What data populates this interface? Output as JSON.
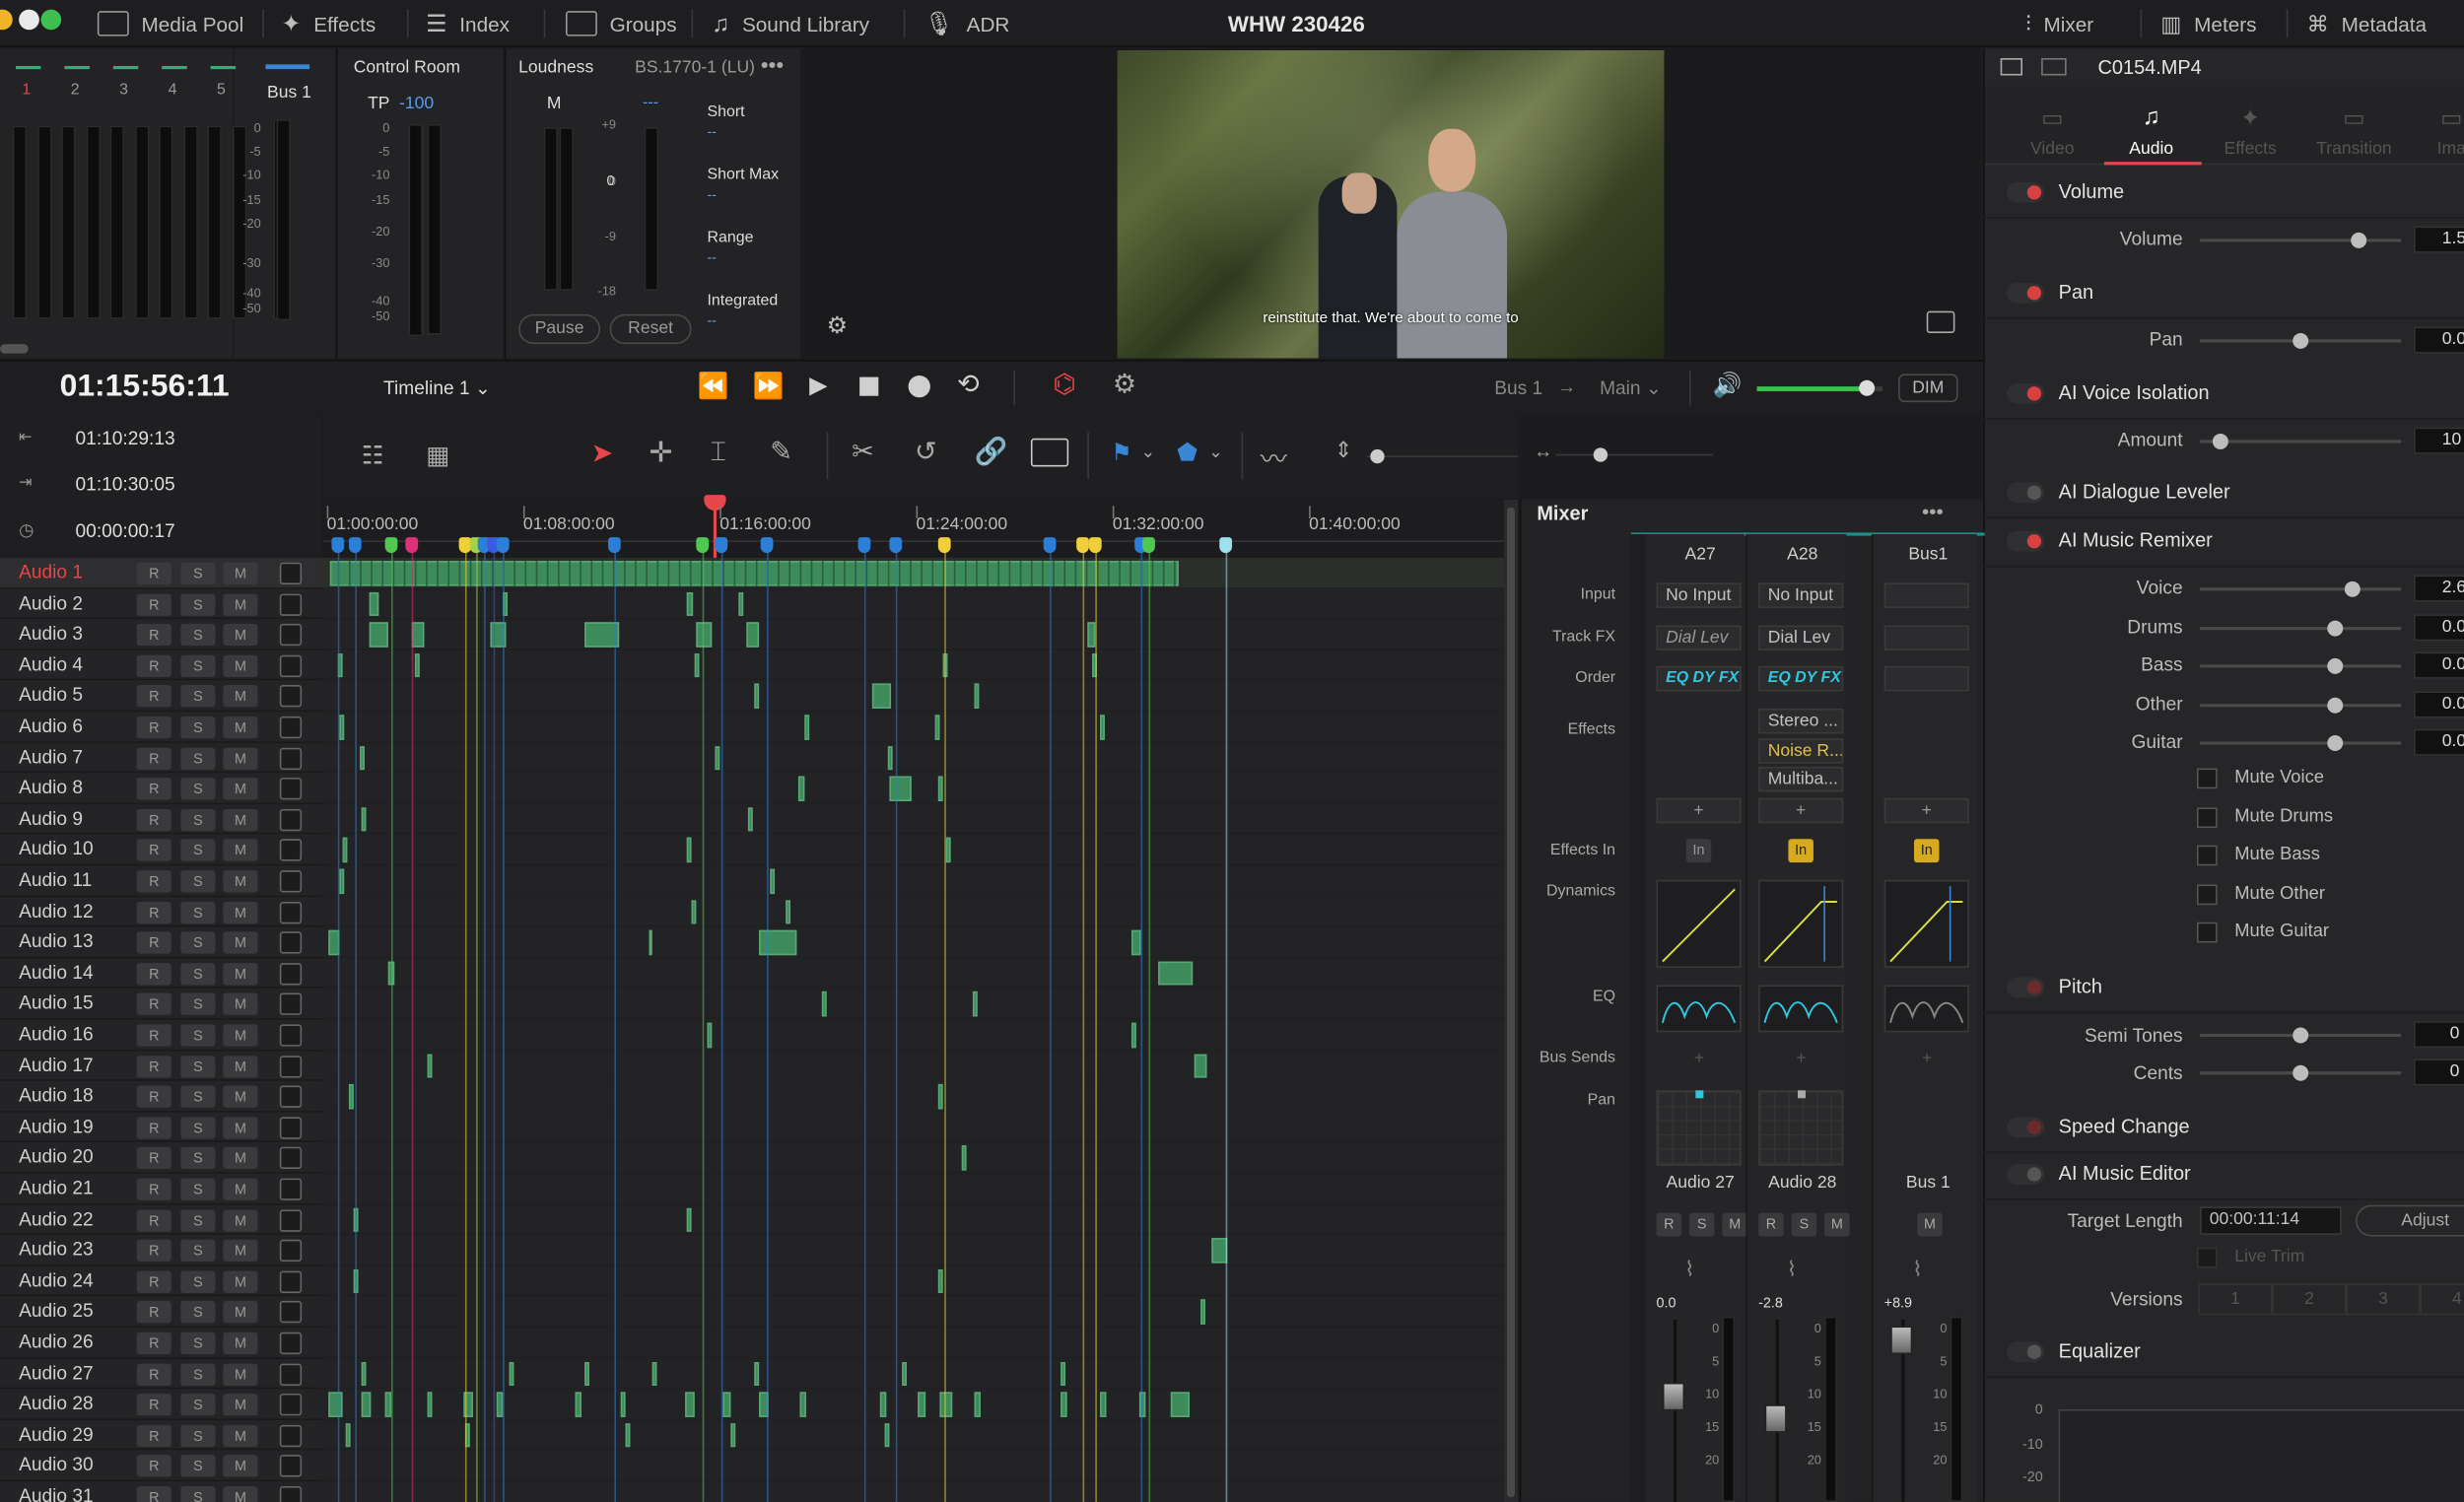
{
  "topbar": {
    "media_pool": "Media Pool",
    "effects": "Effects",
    "index": "Index",
    "groups": "Groups",
    "sound_library": "Sound Library",
    "adr": "ADR",
    "project_title": "WHW 230426",
    "mixer": "Mixer",
    "meters": "Meters",
    "metadata": "Metadata"
  },
  "meters": {
    "channels": [
      "1",
      "2",
      "3",
      "4",
      "5"
    ],
    "bus_label": "Bus 1",
    "scale": [
      "0",
      "-5",
      "-10",
      "-15",
      "-20",
      "-30",
      "-40",
      "-50"
    ]
  },
  "control_room": {
    "title": "Control Room",
    "tp_label": "TP",
    "tp_value": "-100",
    "scale": [
      "0",
      "-5",
      "-10",
      "-15",
      "-20",
      "-30",
      "-40",
      "-50"
    ]
  },
  "loudness": {
    "title": "Loudness",
    "standard": "BS.1770-1 (LU)",
    "m_label": "M",
    "dash": "---",
    "scale": [
      "+9",
      "0",
      "-9",
      "-18"
    ],
    "zero": "0",
    "short": "Short",
    "short_max": "Short Max",
    "range": "Range",
    "integrated": "Integrated",
    "value_dash": "--",
    "pause": "Pause",
    "reset": "Reset"
  },
  "viewer": {
    "subtitle": "reinstitute that. We're about to come to"
  },
  "transport": {
    "timecode": "01:15:56:11",
    "timeline_name": "Timeline 1",
    "bus_route": "Bus 1",
    "arrow": "→",
    "main_route": "Main",
    "dim": "DIM",
    "volume_level": 0.88
  },
  "timecodes": {
    "in": "01:10:29:13",
    "out": "01:10:30:05",
    "duration": "00:00:00:17"
  },
  "ruler": [
    "01:00:00:00",
    "01:08:00:00",
    "01:16:00:00",
    "01:24:00:00",
    "01:32:00:00",
    "01:40:00:00"
  ],
  "tracks": [
    "Audio 1",
    "Audio 2",
    "Audio 3",
    "Audio 4",
    "Audio 5",
    "Audio 6",
    "Audio 7",
    "Audio 8",
    "Audio 9",
    "Audio 10",
    "Audio 11",
    "Audio 12",
    "Audio 13",
    "Audio 14",
    "Audio 15",
    "Audio 16",
    "Audio 17",
    "Audio 18",
    "Audio 19",
    "Audio 20",
    "Audio 21",
    "Audio 22",
    "Audio 23",
    "Audio 24",
    "Audio 25",
    "Audio 26",
    "Audio 27",
    "Audio 28",
    "Audio 29",
    "Audio 30",
    "Audio 31"
  ],
  "track_buttons": {
    "r": "R",
    "s": "S",
    "m": "M"
  },
  "mixer": {
    "title": "Mixer",
    "menu": "•••",
    "row_labels": {
      "input": "Input",
      "track_fx": "Track FX",
      "order": "Order",
      "effects": "Effects",
      "effects_in": "Effects In",
      "dynamics": "Dynamics",
      "eq": "EQ",
      "bus_sends": "Bus Sends",
      "pan": "Pan"
    },
    "cols": [
      {
        "name": "A27",
        "input": "No Input",
        "track_fx": "Dial Lev",
        "order": "EQ DY FX",
        "effects": [],
        "effects_in": "In",
        "strip": "Audio 27",
        "fader": "0.0"
      },
      {
        "name": "A28",
        "input": "No Input",
        "track_fx": "Dial Lev",
        "order": "EQ DY FX",
        "effects": [
          "Stereo ...",
          "Noise R...",
          "Multiba..."
        ],
        "effects_in": "In",
        "strip": "Audio 28",
        "fader": "-2.8"
      },
      {
        "name": "Bus1",
        "input": "",
        "track_fx": "",
        "order": "",
        "effects": [],
        "effects_in": "In",
        "strip": "Bus 1",
        "fader": "+8.9"
      }
    ],
    "plus": "+",
    "fader_scale": [
      "0",
      "5",
      "10",
      "15",
      "20"
    ]
  },
  "inspector": {
    "clip_name": "C0154.MP4",
    "tabs": [
      "Video",
      "Audio",
      "Effects",
      "Transition",
      "Ima"
    ],
    "volume": {
      "title": "Volume",
      "label": "Volume",
      "value": "1.5",
      "level": 0.79
    },
    "pan": {
      "title": "Pan",
      "label": "Pan",
      "value": "0.0",
      "level": 0.5
    },
    "voice_isolation": {
      "title": "AI Voice Isolation",
      "label": "Amount",
      "value": "10",
      "level": 0.1
    },
    "dialogue_leveler": {
      "title": "AI Dialogue Leveler"
    },
    "music_remixer": {
      "title": "AI Music Remixer",
      "stems": [
        {
          "label": "Voice",
          "value": "2.6",
          "level": 0.76
        },
        {
          "label": "Drums",
          "value": "0.0",
          "level": 0.67
        },
        {
          "label": "Bass",
          "value": "0.0",
          "level": 0.67
        },
        {
          "label": "Other",
          "value": "0.0",
          "level": 0.67
        },
        {
          "label": "Guitar",
          "value": "0.0",
          "level": 0.67
        }
      ],
      "mutes": [
        "Mute Voice",
        "Mute Drums",
        "Mute Bass",
        "Mute Other",
        "Mute Guitar"
      ]
    },
    "pitch": {
      "title": "Pitch",
      "semitones_label": "Semi Tones",
      "semitones": "0",
      "cents_label": "Cents",
      "cents": "0"
    },
    "speed_change": {
      "title": "Speed Change"
    },
    "music_editor": {
      "title": "AI Music Editor",
      "target_label": "Target Length",
      "target": "00:00:11:14",
      "adjust": "Adjust",
      "live_trim": "Live Trim",
      "versions_label": "Versions",
      "versions": [
        "1",
        "2",
        "3",
        "4"
      ]
    },
    "equalizer": {
      "title": "Equalizer",
      "scale": [
        "0",
        "-10",
        "-20"
      ]
    }
  },
  "colors": {
    "accent_red": "#e5474a",
    "clip_green": "#3d8b5a",
    "playhead": "#e5474a"
  }
}
